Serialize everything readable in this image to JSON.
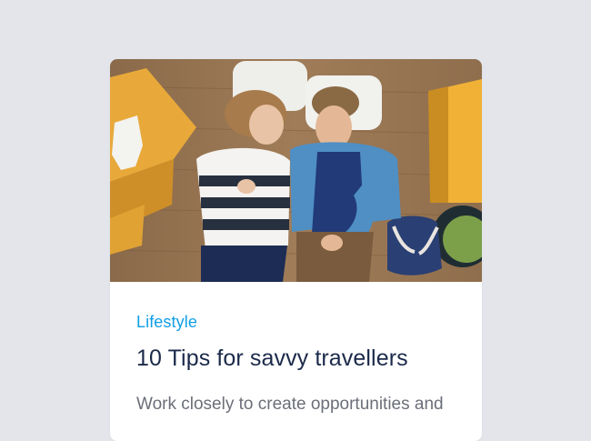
{
  "card": {
    "image_alt": "Couple lying on a wooden floor among moving boxes",
    "category": "Lifestyle",
    "title": "10 Tips for savvy travellers",
    "excerpt": "Work closely to create opportunities and"
  },
  "colors": {
    "background": "#e3e5ea",
    "card": "#ffffff",
    "category": "#0f9ee6",
    "title": "#1b2a4a",
    "excerpt": "#6b6f78"
  }
}
